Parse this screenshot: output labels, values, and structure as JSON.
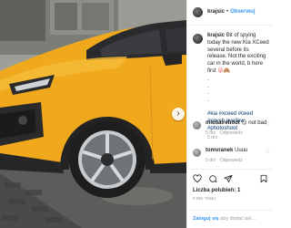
{
  "post": {
    "username": "krajsic",
    "follow_label": "Obserwuj",
    "caption_user": "krajsic",
    "caption_text": "Bit of spying today the new Kia XCeed several before its release. Not the exciting car in the world, b here first",
    "caption_emoji": "😜🙈",
    "dots": ".\n.\n.\n.",
    "hashtags": "#kia #xceed #ceed #spysh #yellow #photoshoot",
    "caption_meta": "5 dni"
  },
  "comments": [
    {
      "user": "michalrehout",
      "text": "😏 not bad",
      "time": "5 dni",
      "reply": "Odpowiedz"
    },
    {
      "user": "tomvranek",
      "text": "Uuuu",
      "time": "5 dni",
      "reply": "Odpowiedz"
    }
  ],
  "likes_label": "Liczba polubień: 1",
  "date_label": "5 DNI TEMU",
  "login": {
    "link": "Zaloguj się",
    "rest": " aby dodać pol..."
  },
  "icons": [
    "heart-icon",
    "comment-icon",
    "share-icon",
    "bookmark-icon",
    "next-arrow-icon"
  ],
  "colors": {
    "link_blue": "#3897f0",
    "hashtag_blue": "#003569",
    "car_yellow": "#f0a91d"
  }
}
